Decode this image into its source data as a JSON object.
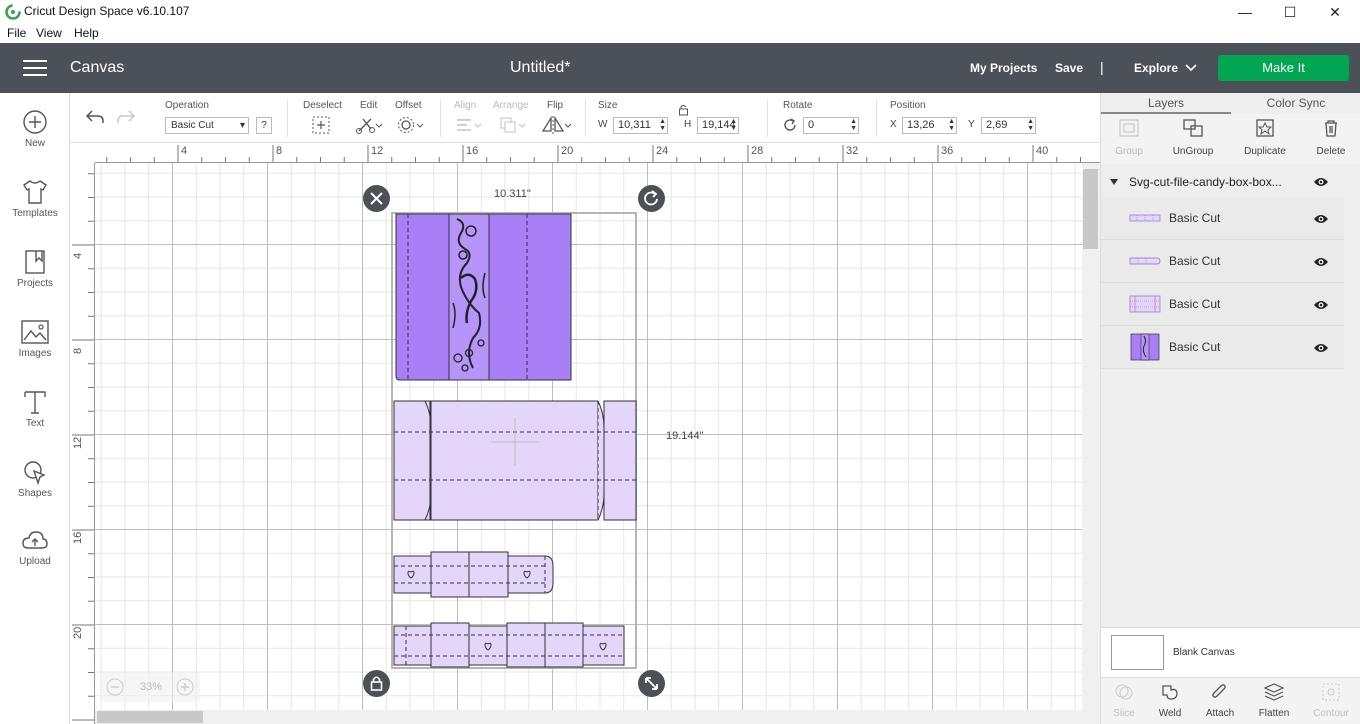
{
  "window": {
    "title": "Cricut Design Space  v6.10.107",
    "controls": {
      "minimize": "—",
      "maximize": "☐",
      "close": "✕"
    }
  },
  "menu": [
    "File",
    "View",
    "Help"
  ],
  "header": {
    "section": "Canvas",
    "document_title": "Untitled*",
    "my_projects": "My Projects",
    "save": "Save",
    "separator": "|",
    "explore": "Explore",
    "make_it": "Make It",
    "make_it_color": "#00a651"
  },
  "sidebar": [
    {
      "label": "New",
      "icon": "plus-circle-icon"
    },
    {
      "label": "Templates",
      "icon": "tshirt-icon"
    },
    {
      "label": "Projects",
      "icon": "bookmark-icon"
    },
    {
      "label": "Images",
      "icon": "image-icon"
    },
    {
      "label": "Text",
      "icon": "text-icon"
    },
    {
      "label": "Shapes",
      "icon": "shapes-icon"
    },
    {
      "label": "Upload",
      "icon": "cloud-upload-icon"
    }
  ],
  "toolbar": {
    "operation_label": "Operation",
    "operation_value": "Basic Cut",
    "help": "?",
    "deselect": "Deselect",
    "edit": "Edit",
    "offset": "Offset",
    "align": "Align",
    "arrange": "Arrange",
    "flip": "Flip",
    "size_label": "Size",
    "w_label": "W",
    "w_value": "10,311",
    "h_label": "H",
    "h_value": "19,144",
    "rotate_label": "Rotate",
    "rotate_value": "0",
    "position_label": "Position",
    "x_label": "X",
    "x_value": "13,26",
    "y_label": "Y",
    "y_value": "2,69"
  },
  "ruler": {
    "top": [
      "4",
      "8",
      "12",
      "16",
      "20",
      "24",
      "28",
      "32",
      "36",
      "40"
    ],
    "left": [
      "4",
      "8",
      "12",
      "16",
      "20"
    ]
  },
  "canvas": {
    "width_readout": "10.311\"",
    "height_readout": "19.144\"",
    "zoom": "33%",
    "fill_dark": "#a97ff7",
    "fill_light": "#e4d5fb"
  },
  "panel": {
    "tabs": [
      "Layers",
      "Color Sync"
    ],
    "actions": [
      {
        "label": "Group",
        "enabled": false
      },
      {
        "label": "UnGroup",
        "enabled": true
      },
      {
        "label": "Duplicate",
        "enabled": true
      },
      {
        "label": "Delete",
        "enabled": true
      }
    ],
    "group_name": "Svg-cut-file-candy-box-box...",
    "layers": [
      "Basic Cut",
      "Basic Cut",
      "Basic Cut",
      "Basic Cut"
    ],
    "blank_canvas": "Blank Canvas",
    "bottom_actions": [
      {
        "label": "Slice",
        "enabled": false
      },
      {
        "label": "Weld",
        "enabled": true
      },
      {
        "label": "Attach",
        "enabled": true
      },
      {
        "label": "Flatten",
        "enabled": true
      },
      {
        "label": "Contour",
        "enabled": false
      }
    ]
  }
}
